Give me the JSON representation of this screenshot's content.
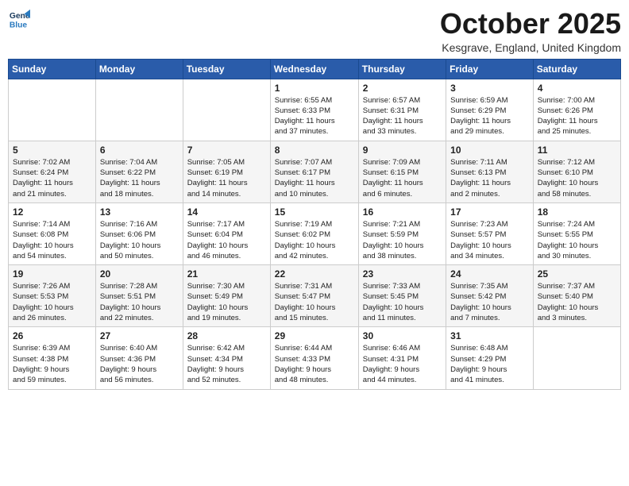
{
  "logo": {
    "line1": "General",
    "line2": "Blue"
  },
  "title": "October 2025",
  "location": "Kesgrave, England, United Kingdom",
  "weekdays": [
    "Sunday",
    "Monday",
    "Tuesday",
    "Wednesday",
    "Thursday",
    "Friday",
    "Saturday"
  ],
  "weeks": [
    [
      {
        "day": "",
        "info": ""
      },
      {
        "day": "",
        "info": ""
      },
      {
        "day": "",
        "info": ""
      },
      {
        "day": "1",
        "info": "Sunrise: 6:55 AM\nSunset: 6:33 PM\nDaylight: 11 hours\nand 37 minutes."
      },
      {
        "day": "2",
        "info": "Sunrise: 6:57 AM\nSunset: 6:31 PM\nDaylight: 11 hours\nand 33 minutes."
      },
      {
        "day": "3",
        "info": "Sunrise: 6:59 AM\nSunset: 6:29 PM\nDaylight: 11 hours\nand 29 minutes."
      },
      {
        "day": "4",
        "info": "Sunrise: 7:00 AM\nSunset: 6:26 PM\nDaylight: 11 hours\nand 25 minutes."
      }
    ],
    [
      {
        "day": "5",
        "info": "Sunrise: 7:02 AM\nSunset: 6:24 PM\nDaylight: 11 hours\nand 21 minutes."
      },
      {
        "day": "6",
        "info": "Sunrise: 7:04 AM\nSunset: 6:22 PM\nDaylight: 11 hours\nand 18 minutes."
      },
      {
        "day": "7",
        "info": "Sunrise: 7:05 AM\nSunset: 6:19 PM\nDaylight: 11 hours\nand 14 minutes."
      },
      {
        "day": "8",
        "info": "Sunrise: 7:07 AM\nSunset: 6:17 PM\nDaylight: 11 hours\nand 10 minutes."
      },
      {
        "day": "9",
        "info": "Sunrise: 7:09 AM\nSunset: 6:15 PM\nDaylight: 11 hours\nand 6 minutes."
      },
      {
        "day": "10",
        "info": "Sunrise: 7:11 AM\nSunset: 6:13 PM\nDaylight: 11 hours\nand 2 minutes."
      },
      {
        "day": "11",
        "info": "Sunrise: 7:12 AM\nSunset: 6:10 PM\nDaylight: 10 hours\nand 58 minutes."
      }
    ],
    [
      {
        "day": "12",
        "info": "Sunrise: 7:14 AM\nSunset: 6:08 PM\nDaylight: 10 hours\nand 54 minutes."
      },
      {
        "day": "13",
        "info": "Sunrise: 7:16 AM\nSunset: 6:06 PM\nDaylight: 10 hours\nand 50 minutes."
      },
      {
        "day": "14",
        "info": "Sunrise: 7:17 AM\nSunset: 6:04 PM\nDaylight: 10 hours\nand 46 minutes."
      },
      {
        "day": "15",
        "info": "Sunrise: 7:19 AM\nSunset: 6:02 PM\nDaylight: 10 hours\nand 42 minutes."
      },
      {
        "day": "16",
        "info": "Sunrise: 7:21 AM\nSunset: 5:59 PM\nDaylight: 10 hours\nand 38 minutes."
      },
      {
        "day": "17",
        "info": "Sunrise: 7:23 AM\nSunset: 5:57 PM\nDaylight: 10 hours\nand 34 minutes."
      },
      {
        "day": "18",
        "info": "Sunrise: 7:24 AM\nSunset: 5:55 PM\nDaylight: 10 hours\nand 30 minutes."
      }
    ],
    [
      {
        "day": "19",
        "info": "Sunrise: 7:26 AM\nSunset: 5:53 PM\nDaylight: 10 hours\nand 26 minutes."
      },
      {
        "day": "20",
        "info": "Sunrise: 7:28 AM\nSunset: 5:51 PM\nDaylight: 10 hours\nand 22 minutes."
      },
      {
        "day": "21",
        "info": "Sunrise: 7:30 AM\nSunset: 5:49 PM\nDaylight: 10 hours\nand 19 minutes."
      },
      {
        "day": "22",
        "info": "Sunrise: 7:31 AM\nSunset: 5:47 PM\nDaylight: 10 hours\nand 15 minutes."
      },
      {
        "day": "23",
        "info": "Sunrise: 7:33 AM\nSunset: 5:45 PM\nDaylight: 10 hours\nand 11 minutes."
      },
      {
        "day": "24",
        "info": "Sunrise: 7:35 AM\nSunset: 5:42 PM\nDaylight: 10 hours\nand 7 minutes."
      },
      {
        "day": "25",
        "info": "Sunrise: 7:37 AM\nSunset: 5:40 PM\nDaylight: 10 hours\nand 3 minutes."
      }
    ],
    [
      {
        "day": "26",
        "info": "Sunrise: 6:39 AM\nSunset: 4:38 PM\nDaylight: 9 hours\nand 59 minutes."
      },
      {
        "day": "27",
        "info": "Sunrise: 6:40 AM\nSunset: 4:36 PM\nDaylight: 9 hours\nand 56 minutes."
      },
      {
        "day": "28",
        "info": "Sunrise: 6:42 AM\nSunset: 4:34 PM\nDaylight: 9 hours\nand 52 minutes."
      },
      {
        "day": "29",
        "info": "Sunrise: 6:44 AM\nSunset: 4:33 PM\nDaylight: 9 hours\nand 48 minutes."
      },
      {
        "day": "30",
        "info": "Sunrise: 6:46 AM\nSunset: 4:31 PM\nDaylight: 9 hours\nand 44 minutes."
      },
      {
        "day": "31",
        "info": "Sunrise: 6:48 AM\nSunset: 4:29 PM\nDaylight: 9 hours\nand 41 minutes."
      },
      {
        "day": "",
        "info": ""
      }
    ]
  ]
}
